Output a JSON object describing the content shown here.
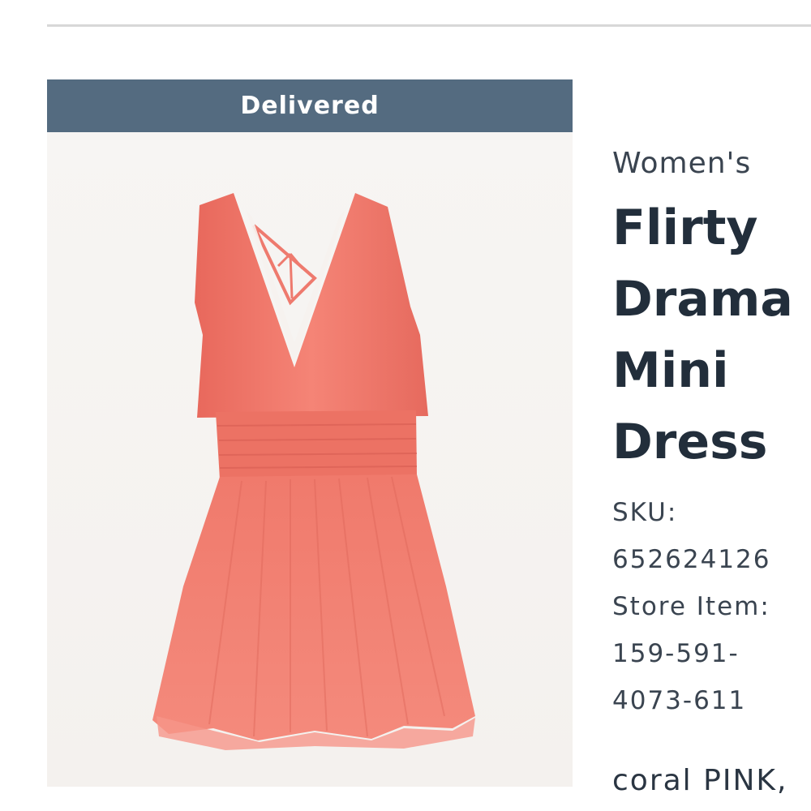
{
  "order": {
    "status": "Delivered"
  },
  "product": {
    "image_icon": "dress-photo-icon",
    "category": "Women's",
    "title_lines": [
      "Flirty",
      "Drama",
      "Mini",
      "Dress"
    ],
    "sku_label": "SKU:",
    "sku_value": "652624126",
    "store_item_label": "Store Item:",
    "store_item_lines": [
      "159-591-",
      "4073-611"
    ],
    "color": "coral PINK,"
  },
  "colors": {
    "status_bar": "#546b80",
    "dress": "#f0786a",
    "title_text": "#222e3b"
  }
}
